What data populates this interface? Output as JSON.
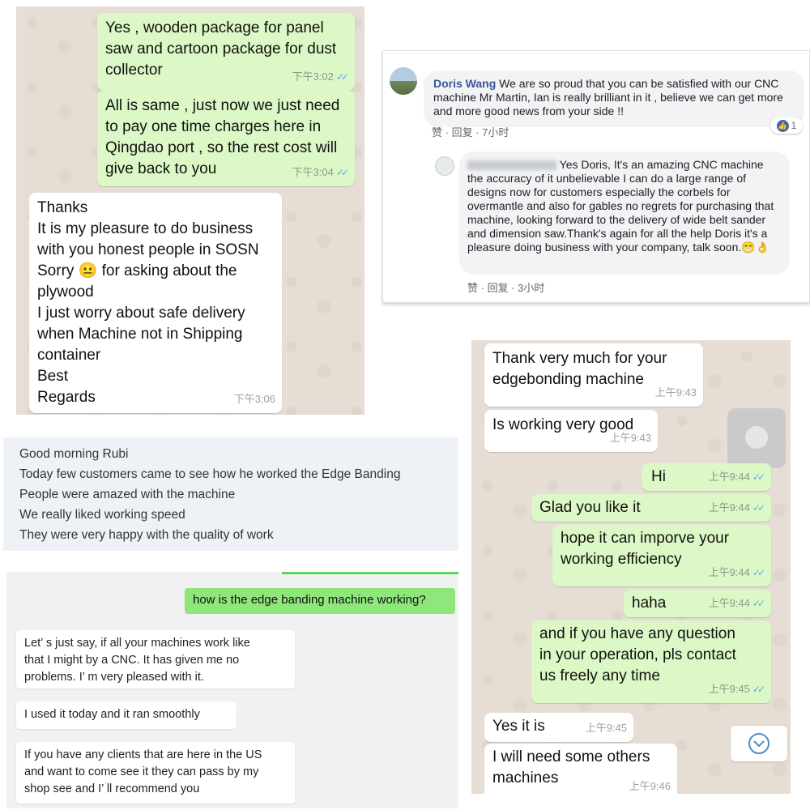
{
  "whatsapp_top": {
    "messages": [
      {
        "text": "Yes , wooden package for panel\nsaw and cartoon package for dust\ncollector",
        "time": "下午3:02",
        "dir": "out"
      },
      {
        "text": "All is same , just now we just need\nto pay one time charges here in\nQingdao port , so the rest cost will\ngive back to you",
        "time": "下午3:04",
        "dir": "out"
      },
      {
        "text": "Thanks\nIt is my pleasure to do business\nwith you honest people in SOSN\nSorry 😐 for asking about the\nplywood\nI just worry about safe delivery\nwhen Machine not in Shipping\ncontainer\nBest\nRegards",
        "time": "下午3:06",
        "dir": "in"
      }
    ]
  },
  "facebook": {
    "comment": {
      "name": "Doris Wang",
      "text": "We are so proud that you can be satisfied with our CNC machine Mr Martin, Ian is really brilliant in it , believe we can get more and more good news from your side !!",
      "like": "赞",
      "reply": "回复",
      "time": "7小时",
      "reaction_count": "1"
    },
    "reply": {
      "text": "Yes Doris, It's an amazing CNC machine the accuracy of it unbelievable I can do a large range of designs now for customers especially the corbels for overmantle and also for gables no regrets for purchasing that machine, looking forward to the delivery of wide belt sander and dimension saw.Thank's again for all the help Doris it's a pleasure doing business with your company, talk soon.😁👌",
      "like": "赞",
      "reply": "回复",
      "time": "3小时"
    }
  },
  "chat_rubi": {
    "lines": [
      "Good morning Rubi",
      "Today few customers came to see how he worked the Edge Banding",
      "People were amazed with the machine",
      "We really liked working speed",
      "They were very happy with the quality of work"
    ]
  },
  "chat_us": {
    "outgoing": "how is the edge banding machine working?",
    "incoming": [
      "Let’ s just say, if all your machines work like\nthat I might by a CNC. It has given me no\nproblems. I’ m very pleased with it.",
      "I used it today and it ran smoothly",
      "If you have any clients that are here in the US\nand want to come see it they can pass by my\nshop see and I’ ll recommend you"
    ]
  },
  "whatsapp_right": {
    "messages": [
      {
        "text": "Thank very much for your\nedgebonding  machine",
        "time": "上午9:43",
        "dir": "in"
      },
      {
        "text": "Is working very good",
        "time": "上午9:43",
        "dir": "in"
      },
      {
        "text": "Hi",
        "time": "上午9:44",
        "dir": "out"
      },
      {
        "text": "Glad you like it",
        "time": "上午9:44",
        "dir": "out"
      },
      {
        "text": "hope it can imporve your\nworking efficiency",
        "time": "上午9:44",
        "dir": "out"
      },
      {
        "text": "haha",
        "time": "上午9:44",
        "dir": "out"
      },
      {
        "text": "and if you have any question\nin your operation, pls contact\nus freely any time",
        "time": "上午9:45",
        "dir": "out"
      },
      {
        "text": "Yes it is",
        "time": "上午9:45",
        "dir": "in"
      },
      {
        "text": "I will need some others\nmachines",
        "time": "上午9:46",
        "dir": "in"
      }
    ]
  },
  "colors": {
    "wa_out": "#dcf8c6",
    "wa_in": "#ffffff",
    "wa_bg": "#e6ddd4",
    "fb_name": "#385898",
    "read_tick": "#4fb3e8",
    "chat_out": "#8fe67a"
  },
  "icons": [
    "double-check-icon",
    "like-reaction-icon",
    "scroll-down-icon",
    "avatar"
  ]
}
